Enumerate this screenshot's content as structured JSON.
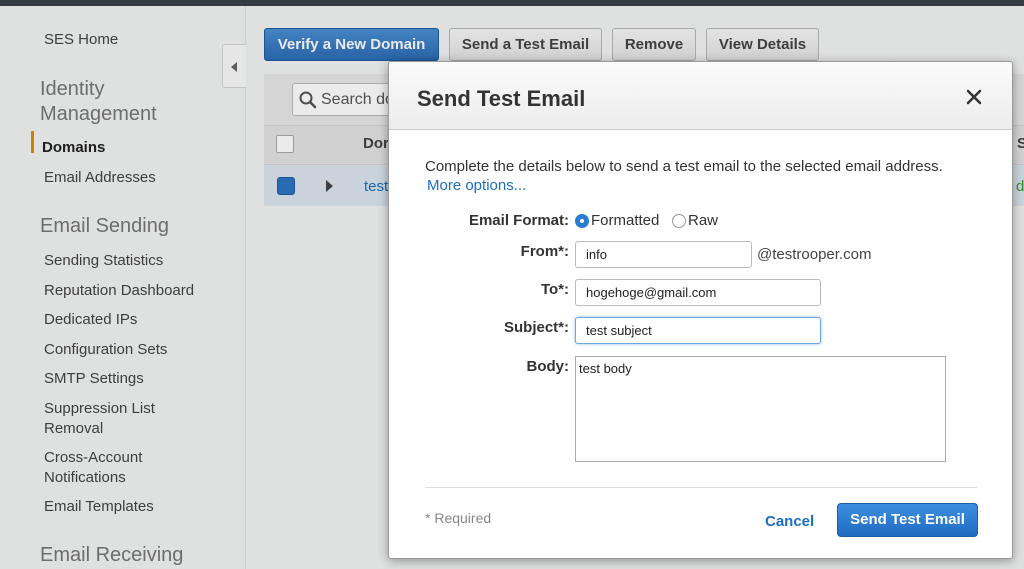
{
  "sidebar": {
    "ses_home": "SES Home",
    "identity_heading": "Identity Management",
    "domains": "Domains",
    "email_addresses": "Email Addresses",
    "sending_heading": "Email Sending",
    "sending_statistics": "Sending Statistics",
    "reputation_dashboard": "Reputation Dashboard",
    "dedicated_ips": "Dedicated IPs",
    "configuration_sets": "Configuration Sets",
    "smtp_settings": "SMTP Settings",
    "suppression_list": "Suppression List Removal",
    "cross_account": "Cross-Account Notifications",
    "email_templates": "Email Templates",
    "receiving_heading": "Email Receiving"
  },
  "toolbar": {
    "verify_domain": "Verify a New Domain",
    "send_test": "Send a Test Email",
    "remove": "Remove",
    "view_details": "View Details"
  },
  "table": {
    "search_placeholder": "Search do",
    "header_col": "Dor",
    "row_text": "test",
    "right_header_fragment": "S",
    "right_row_fragment": "d"
  },
  "modal": {
    "title": "Send Test Email",
    "intro": "Complete the details below to send a test email to the selected email address.",
    "more_options": "More options...",
    "email_format_label": "Email Format:",
    "format_formatted": "Formatted",
    "format_raw": "Raw",
    "from_label": "From*:",
    "from_value": "info",
    "from_suffix": "@testrooper.com",
    "to_label": "To*:",
    "to_value": "hogehoge@gmail.com",
    "subject_label": "Subject*:",
    "subject_value": "test subject",
    "body_label": "Body:",
    "body_value": "test body",
    "required_note": "* Required",
    "cancel": "Cancel",
    "send": "Send Test Email"
  },
  "colors": {
    "primary": "#2b6cb5",
    "link": "#1a6ec0",
    "active_marker": "#e68a00"
  }
}
